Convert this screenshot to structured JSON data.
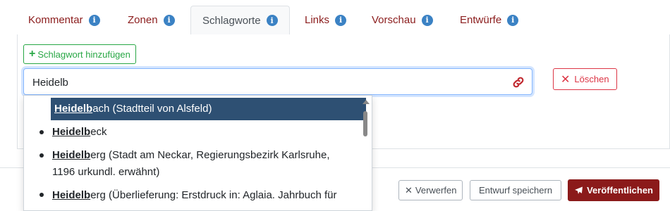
{
  "tabs": [
    {
      "label": "Kommentar",
      "active": false
    },
    {
      "label": "Zonen",
      "active": false
    },
    {
      "label": "Schlagworte",
      "active": true
    },
    {
      "label": "Links",
      "active": false
    },
    {
      "label": "Vorschau",
      "active": false
    },
    {
      "label": "Entwürfe",
      "active": false
    }
  ],
  "info_icon": "i",
  "add_keyword_label": "Schlagwort hinzufügen",
  "search": {
    "value": "Heidelb"
  },
  "delete_label": "Löschen",
  "suggestions": [
    {
      "match": "Heidelb",
      "rest": "ach (Stadtteil von Alsfeld)",
      "cont": ""
    },
    {
      "match": "Heidelb",
      "rest": "eck",
      "cont": ""
    },
    {
      "match": "Heidelb",
      "rest": "erg (Stadt am Neckar, Regierungsbezirk Karlsruhe,",
      "cont": "1196 urkundl. erwähnt)"
    },
    {
      "match": "Heidelb",
      "rest": "erg (Überlieferung: Erstdruck in: Aglaia. Jahrbuch für",
      "cont": ""
    }
  ],
  "footer": {
    "discard_label": "Verwerfen",
    "save_draft_label": "Entwurf speichern",
    "publish_label": "Veröffentlichen"
  },
  "colors": {
    "accent": "#8b1a1a",
    "info": "#3b82c4",
    "success": "#28a745",
    "danger": "#dc3545",
    "highlight": "#2e5073"
  }
}
